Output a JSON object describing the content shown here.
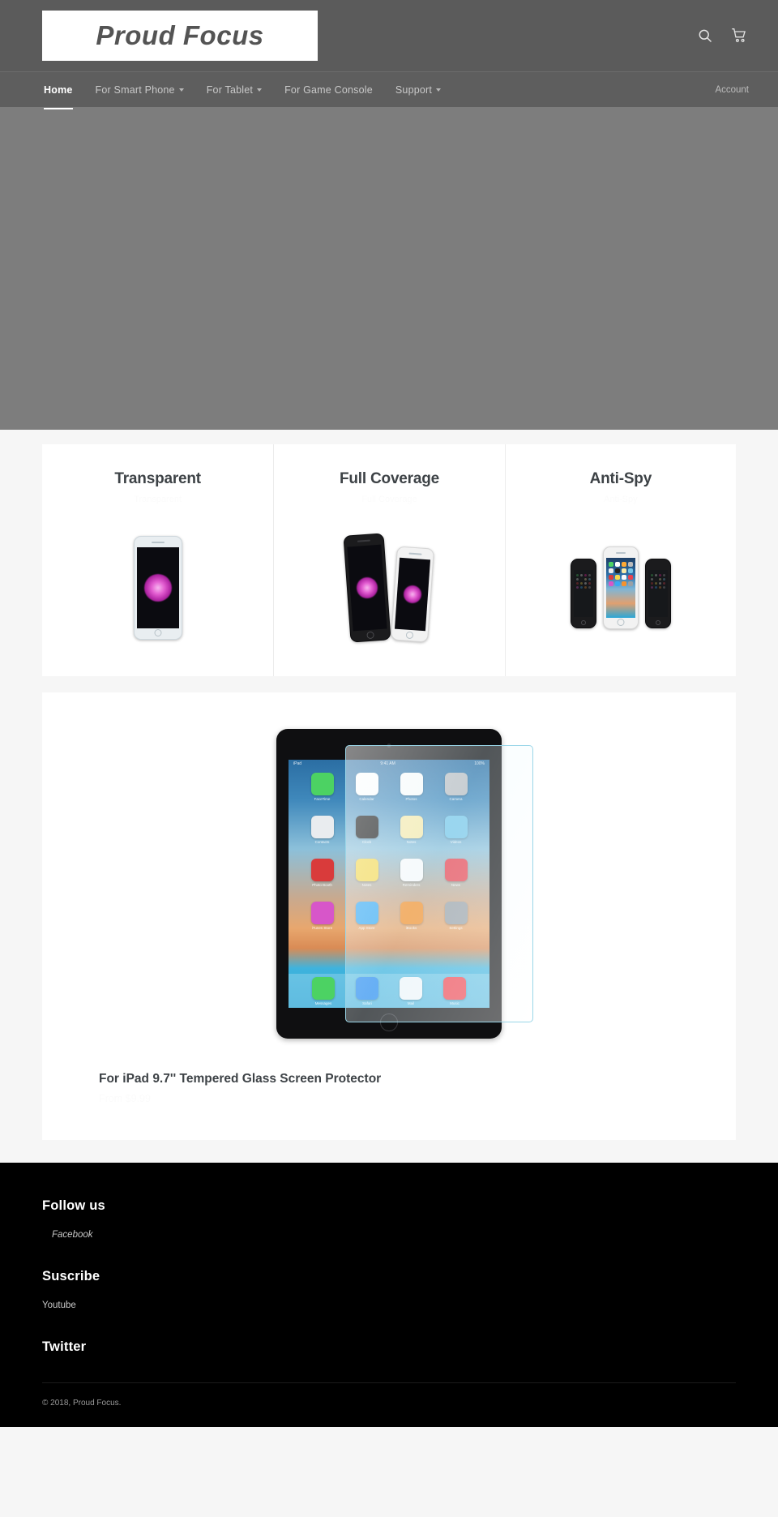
{
  "header": {
    "logo_text": "Proud Focus",
    "icons": [
      {
        "name": "search-icon",
        "label": "Search"
      },
      {
        "name": "cart-icon",
        "label": "Cart"
      }
    ]
  },
  "nav": {
    "items": [
      {
        "label": "Home",
        "has_caret": false,
        "active": true
      },
      {
        "label": "For Smart Phone",
        "has_caret": true,
        "active": false
      },
      {
        "label": "For Tablet",
        "has_caret": true,
        "active": false
      },
      {
        "label": "For Game Console",
        "has_caret": false,
        "active": false
      },
      {
        "label": "Support",
        "has_caret": true,
        "active": false
      }
    ],
    "account_label": "Account"
  },
  "hero": {
    "background_color": "#7d7d7d"
  },
  "features": [
    {
      "title": "Transparent",
      "subtitle": "Transparent"
    },
    {
      "title": "Full Coverage",
      "subtitle": "Full Coverage"
    },
    {
      "title": "Anti-Spy",
      "subtitle": "Anti-Spy"
    }
  ],
  "product": {
    "title": "For iPad 9.7'' Tempered Glass Screen Protector",
    "price": "From $9.99",
    "ipad_status_left": "iPad",
    "ipad_status_center": "9:41 AM",
    "ipad_status_right": "100%",
    "apps": [
      {
        "label": "FaceTime",
        "color": "#4cd263"
      },
      {
        "label": "Calendar",
        "color": "#fdfdfd"
      },
      {
        "label": "Photos",
        "color": "#fbfbfb"
      },
      {
        "label": "Camera",
        "color": "#b9bcc0"
      },
      {
        "label": "Contacts",
        "color": "#e9ecef"
      },
      {
        "label": "Clock",
        "color": "#111111"
      },
      {
        "label": "Notes",
        "color": "#f7e9a8"
      },
      {
        "label": "Videos",
        "color": "#76c6e8"
      },
      {
        "label": "Photo Booth",
        "color": "#d93b3b"
      },
      {
        "label": "Notes",
        "color": "#f6d84e"
      },
      {
        "label": "Reminders",
        "color": "#fafafa"
      },
      {
        "label": "News",
        "color": "#e8434f"
      },
      {
        "label": "iTunes Store",
        "color": "#d756c9"
      },
      {
        "label": "App Store",
        "color": "#39a9f2"
      },
      {
        "label": "iBooks",
        "color": "#f5922e"
      },
      {
        "label": "Settings",
        "color": "#9aa0a6"
      }
    ],
    "dock": [
      {
        "label": "Messages",
        "color": "#4cd263"
      },
      {
        "label": "Safari",
        "color": "#2f8ff0"
      },
      {
        "label": "Mail",
        "color": "#f2f6f9"
      },
      {
        "label": "Music",
        "color": "#f0444f"
      }
    ]
  },
  "footer": {
    "blocks": [
      {
        "heading": "Follow us",
        "link": "Facebook",
        "indent": true
      },
      {
        "heading": "Suscribe",
        "link": "Youtube",
        "indent": false
      },
      {
        "heading": "Twitter",
        "link": "",
        "indent": false
      }
    ],
    "copyright": "© 2018, Proud Focus."
  },
  "colors": {
    "header_bg": "#5b5b5b",
    "nav_bg": "#5e5e5e",
    "hero_bg": "#7d7d7d",
    "page_bg": "#f6f6f6",
    "card_bg": "#ffffff",
    "footer_bg": "#000000",
    "heading_text": "#3d4246"
  }
}
